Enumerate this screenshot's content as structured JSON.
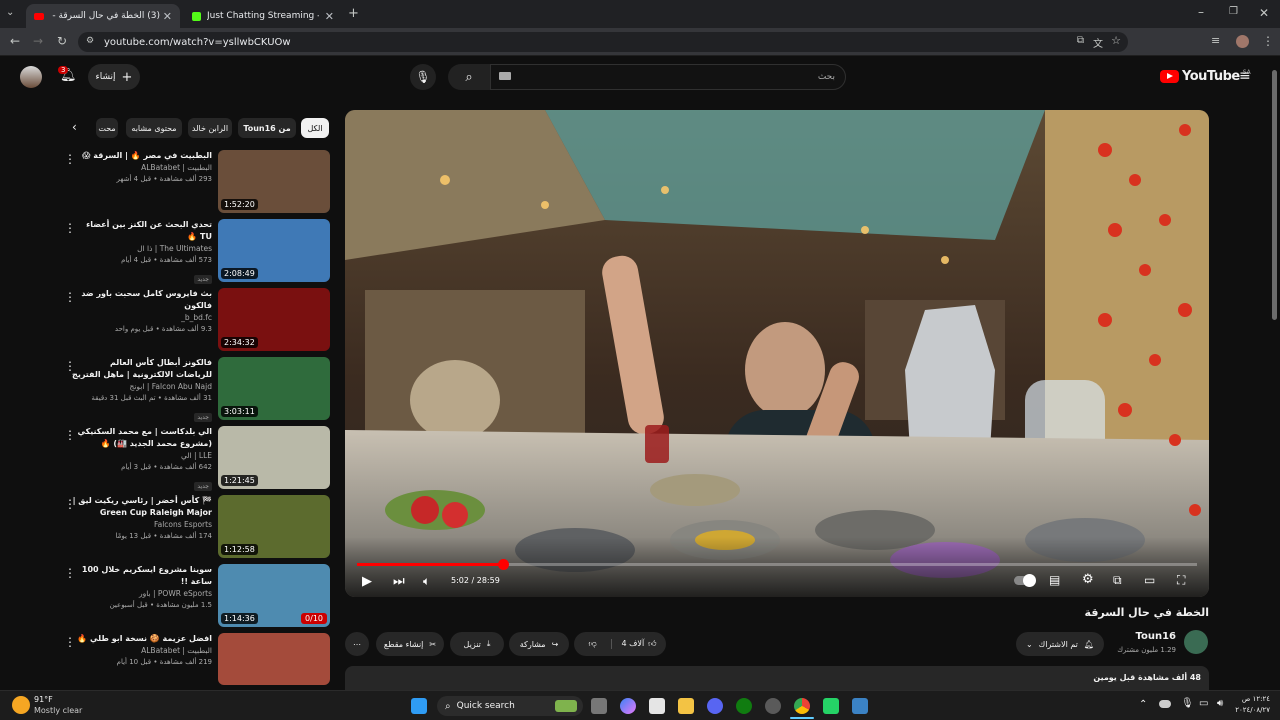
{
  "tabs": [
    {
      "label": "(3) الخطة في حال السرقة - YouTube",
      "active": true
    },
    {
      "label": "Just Chatting Streaming - Live",
      "active": false
    }
  ],
  "url": "youtube.com/watch?v=ysllwbCKUOw",
  "header": {
    "create_label": "إنشاء",
    "notification_count": "3",
    "search_placeholder": "بحث",
    "logo_text": "YouTube",
    "region": "SA"
  },
  "chips": [
    {
      "label": "الكل",
      "selected": true
    },
    {
      "label": "من Toun16",
      "selected": false
    },
    {
      "label": "الرابن خالد",
      "selected": false
    },
    {
      "label": "محتوى مشابه",
      "selected": false
    },
    {
      "label": "محت",
      "selected": false
    }
  ],
  "videos": [
    {
      "title": "البطبيت في مصر 🔥 | السرقة 😱",
      "channel": "البطبيت | ALBatabet",
      "meta": "293 ألف مشاهدة • قبل 4 أشهر",
      "duration": "1:52:20",
      "badge": "",
      "new": "",
      "thumb_color": "#6a4e3a"
    },
    {
      "title": "تحدي البحث عن الكنز بين أعضاء TU 🔥",
      "channel": "The Ultimates | ذا ال",
      "meta": "573 ألف مشاهدة • قبل 4 أيام",
      "duration": "2:08:49",
      "badge": "",
      "new": "جديد",
      "thumb_color": "#3f79b6"
    },
    {
      "title": "بث فايروس كامل سحبت باور ضد فالكون",
      "channel": "b_bd.fc_",
      "meta": "9.3 ألف مشاهدة • قبل يوم واحد",
      "duration": "2:34:32",
      "badge": "",
      "new": "",
      "thumb_color": "#7a1010"
    },
    {
      "title": "فالكونز أبطال كأس العالم للرياضات الالكترونية | ماهل الفتريج",
      "channel": "Falcon Abu Najd | ابونج",
      "meta": "31 ألف مشاهدة • تم البث قبل 31 دقيقة",
      "duration": "3:03:11",
      "badge": "",
      "new": "جديد",
      "thumb_color": "#2f6b3c"
    },
    {
      "title": "الي بلدكاست | مع محمد السكنيكي (مشروع محمد الجديد 🏭) 🔥",
      "channel": "LLE | الي",
      "meta": "642 ألف مشاهدة • قبل 3 أيام",
      "duration": "1:21:45",
      "badge": "",
      "new": "جديد",
      "thumb_color": "#b9b9a8"
    },
    {
      "title": "🏁 كأس أخضر | رئاسي ريكيت ليق | Green Cup Raleigh Major",
      "channel": "Falcons Esports",
      "meta": "174 ألف مشاهدة • قبل 13 يومًا",
      "duration": "1:12:58",
      "badge": "",
      "new": "",
      "thumb_color": "#5c6b2e"
    },
    {
      "title": "سوينا مشروع ايسكريم خلال 100 ساعة !!",
      "channel": "POWR eSports | باور",
      "meta": "1.5 مليون مشاهدة • قبل أسبوعين",
      "duration": "1:14:36",
      "badge": "0/10",
      "new": "",
      "thumb_color": "#4e8bb0"
    },
    {
      "title": "افضل عزيمة 🍪 نسخة ابو طلي 🔥",
      "channel": "البطبيت | ALBatabet",
      "meta": "219 ألف مشاهدة • قبل 10 أيام",
      "duration": "",
      "badge": "",
      "new": "",
      "thumb_color": "#a44b3b"
    }
  ],
  "player": {
    "time": "5:02 / 28:59",
    "progress": 0.174
  },
  "video": {
    "title": "الخطة في حال السرقة",
    "channel": "Toun16",
    "subscribers": "1.29 مليون مشترك",
    "subscribe_label": "تم الاشتراك",
    "likes": "4 آلاف",
    "share_label": "مشاركة",
    "download_label": "تنزيل",
    "clip_label": "إنشاء مقطع",
    "views": "48 ألف مشاهدة قبل يومين"
  },
  "taskbar": {
    "weather_temp": "91°F",
    "weather_text": "Mostly clear",
    "search_label": "Quick search",
    "time": "١٢:٢٤ ص",
    "date": "٢٠٢٤/٠٨/٢٧"
  }
}
